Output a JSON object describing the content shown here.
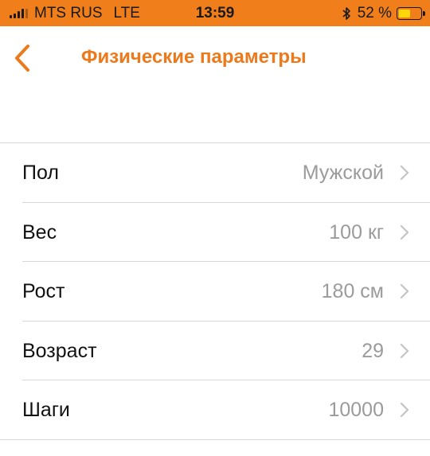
{
  "status_bar": {
    "carrier": "MTS RUS",
    "network": "LTE",
    "time": "13:59",
    "battery_text": "52 %",
    "battery_level": 0.52,
    "background_color": "#f07e1a",
    "battery_color": "#ffd60a"
  },
  "nav": {
    "title": "Физические параметры",
    "back_icon": "chevron-left-icon",
    "accent_color": "#ec7a1c"
  },
  "rows": [
    {
      "label": "Пол",
      "value": "Мужской"
    },
    {
      "label": "Вес",
      "value": "100 кг"
    },
    {
      "label": "Рост",
      "value": "180 см"
    },
    {
      "label": "Возраст",
      "value": "29"
    },
    {
      "label": "Шаги",
      "value": "10000"
    }
  ]
}
